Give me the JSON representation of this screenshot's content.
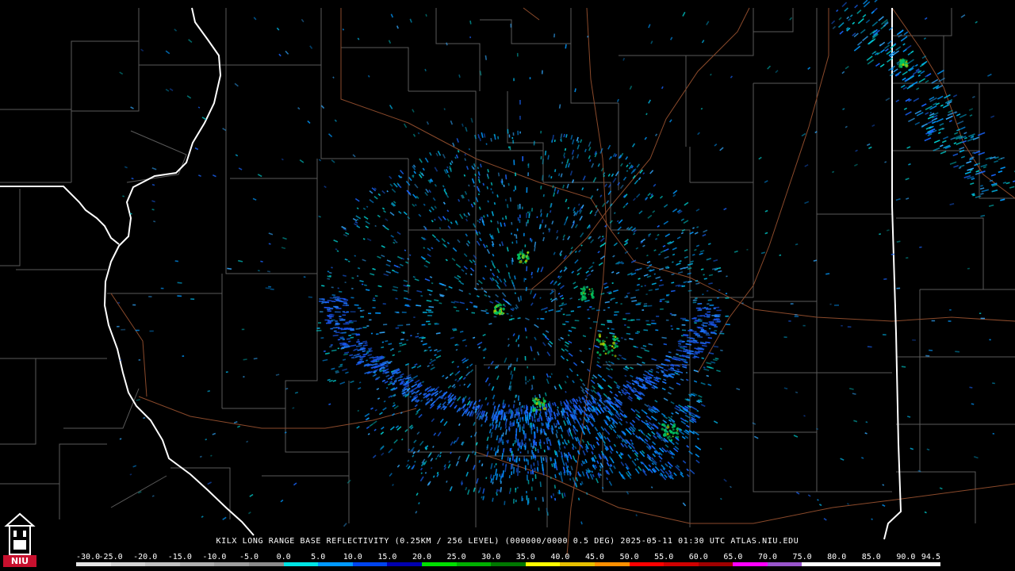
{
  "product": {
    "caption": "KILX LONG RANGE BASE REFLECTIVITY (0.25KM / 256 LEVEL) (000000/0000 0.5 DEG) 2025-05-11 01:30 UTC  ATLAS.NIU.EDU"
  },
  "logo": {
    "text": "NIU",
    "color": "#c8102e"
  },
  "colorscale": {
    "labels": [
      "-30.0",
      "-25.0",
      "-20.0",
      "-15.0",
      "-10.0",
      "-5.0",
      "0.0",
      "5.0",
      "10.0",
      "15.0",
      "20.0",
      "25.0",
      "30.0",
      "35.0",
      "40.0",
      "45.0",
      "50.0",
      "55.0",
      "60.0",
      "65.0",
      "70.0",
      "75.0",
      "80.0",
      "85.0",
      "90.0",
      "94.5"
    ],
    "colors": [
      "#e6e6e6",
      "#d4d4d4",
      "#c2c2c2",
      "#b0b0b0",
      "#9e9e9e",
      "#8c8c8c",
      "#00e5e5",
      "#0099ff",
      "#0044ee",
      "#0000b0",
      "#00e000",
      "#00b000",
      "#007800",
      "#ffff00",
      "#e8c000",
      "#ff9000",
      "#ff0000",
      "#d00000",
      "#a00000",
      "#ff00ff",
      "#9955cc",
      "#ffffff",
      "#ffffff",
      "#ffffff",
      "#ffffff"
    ]
  },
  "map_colors": {
    "county": "#5a5a5a",
    "state": "#ffffff",
    "highway": "#8b4a2b"
  }
}
